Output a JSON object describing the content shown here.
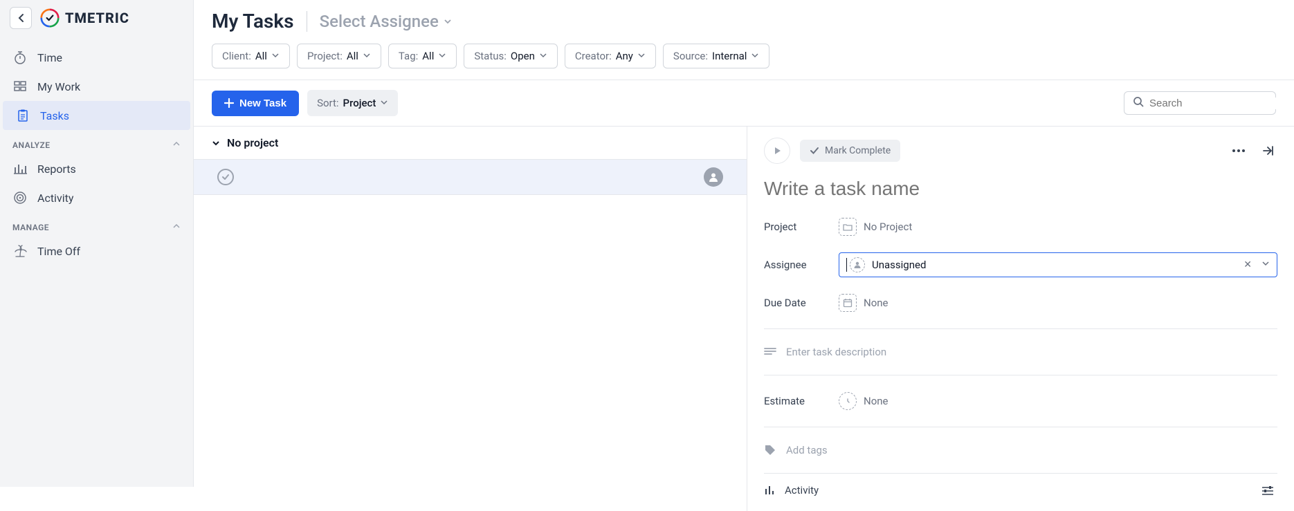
{
  "brand": "TMETRIC",
  "sidebar": {
    "items": [
      {
        "label": "Time"
      },
      {
        "label": "My Work"
      },
      {
        "label": "Tasks"
      }
    ],
    "sections": {
      "analyze": {
        "title": "ANALYZE",
        "items": [
          {
            "label": "Reports"
          },
          {
            "label": "Activity"
          }
        ]
      },
      "manage": {
        "title": "MANAGE",
        "items": [
          {
            "label": "Time Off"
          }
        ]
      }
    }
  },
  "header": {
    "title": "My Tasks",
    "assignee_select": "Select Assignee"
  },
  "filters": [
    {
      "label": "Client:",
      "value": "All"
    },
    {
      "label": "Project:",
      "value": "All"
    },
    {
      "label": "Tag:",
      "value": "All"
    },
    {
      "label": "Status:",
      "value": "Open"
    },
    {
      "label": "Creator:",
      "value": "Any"
    },
    {
      "label": "Source:",
      "value": "Internal"
    }
  ],
  "toolbar": {
    "new_task": "New Task",
    "sort_label": "Sort:",
    "sort_value": "Project",
    "search_placeholder": "Search"
  },
  "list": {
    "group_title": "No project"
  },
  "detail": {
    "mark_complete": "Mark Complete",
    "task_name_placeholder": "Write a task name",
    "fields": {
      "project_label": "Project",
      "project_value": "No Project",
      "assignee_label": "Assignee",
      "assignee_value": "Unassigned",
      "due_label": "Due Date",
      "due_value": "None",
      "desc_placeholder": "Enter task description",
      "estimate_label": "Estimate",
      "estimate_value": "None",
      "add_tags": "Add tags",
      "activity_label": "Activity"
    }
  }
}
